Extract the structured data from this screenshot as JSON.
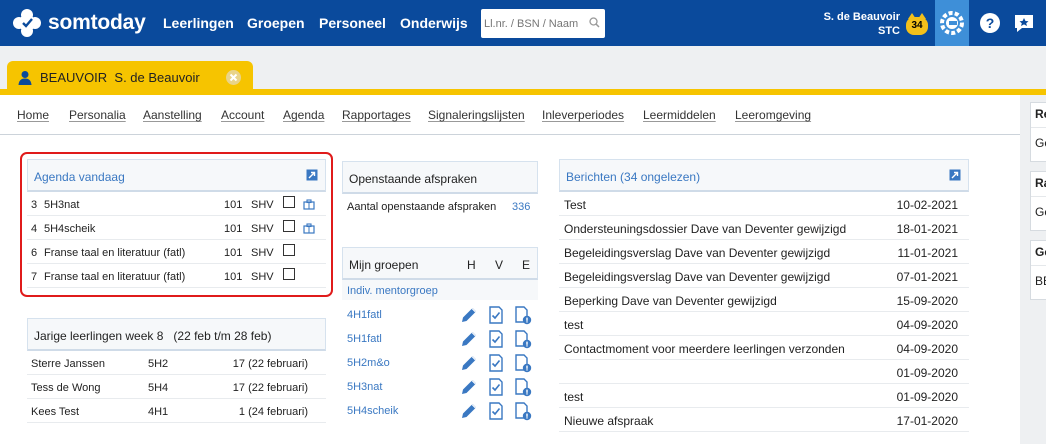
{
  "app": {
    "name": "somtoday"
  },
  "topnav": [
    {
      "label": "Leerlingen"
    },
    {
      "label": "Groepen"
    },
    {
      "label": "Personeel"
    },
    {
      "label": "Onderwijs"
    }
  ],
  "search": {
    "placeholder": "Ll.nr. / BSN / Naam"
  },
  "user": {
    "name": "S. de Beauvoir",
    "org": "STC",
    "notifications": "34"
  },
  "tab": {
    "label": "BEAUVOIR  S. de Beauvoir"
  },
  "subnav": [
    "Home",
    "Personalia",
    "Aanstelling",
    "Account",
    "Agenda",
    "Rapportages",
    "Signaleringslijsten",
    "Inleverperiodes",
    "Leermiddelen",
    "Leeromgeving"
  ],
  "agenda": {
    "title": "Agenda vandaag",
    "rows": [
      {
        "hour": "3",
        "subject": "5H3nat",
        "room": "101",
        "teacher": "SHV",
        "bag": true
      },
      {
        "hour": "4",
        "subject": "5H4scheik",
        "room": "101",
        "teacher": "SHV",
        "bag": true
      },
      {
        "hour": "6",
        "subject": "Franse taal en literatuur (fatl)",
        "room": "101",
        "teacher": "SHV",
        "bag": false
      },
      {
        "hour": "7",
        "subject": "Franse taal en literatuur (fatl)",
        "room": "101",
        "teacher": "SHV",
        "bag": false
      }
    ]
  },
  "birthdays": {
    "title": "Jarige leerlingen week 8   (22 feb t/m 28 feb)",
    "rows": [
      {
        "name": "Sterre Janssen",
        "class": "5H2",
        "date": "17 (22 februari)"
      },
      {
        "name": "Tess de Wong",
        "class": "5H4",
        "date": "17 (22 februari)"
      },
      {
        "name": "Kees Test",
        "class": "4H1",
        "date": "1 (24 februari)"
      }
    ]
  },
  "appointments": {
    "title": "Openstaande afspraken",
    "label": "Aantal openstaande afspraken",
    "count": "336"
  },
  "groups": {
    "title": "Mijn groepen",
    "col_h": "H",
    "col_v": "V",
    "col_e": "E",
    "mentor_label": "Indiv. mentorgroep",
    "items": [
      "4H1fatl",
      "5H1fatl",
      "5H2m&o",
      "5H3nat",
      "5H4scheik"
    ]
  },
  "messages": {
    "title": "Berichten (34 ongelezen)",
    "rows": [
      {
        "subject": "Test",
        "date": "10-02-2021"
      },
      {
        "subject": "Ondersteuningsdossier Dave van Deventer gewijzigd",
        "date": "18-01-2021"
      },
      {
        "subject": "Begeleidingsverslag Dave van Deventer gewijzigd",
        "date": "11-01-2021"
      },
      {
        "subject": "Begeleidingsverslag Dave van Deventer gewijzigd",
        "date": "07-01-2021"
      },
      {
        "subject": "Beperking Dave van Deventer gewijzigd",
        "date": "15-09-2020"
      },
      {
        "subject": "test",
        "date": "04-09-2020"
      },
      {
        "subject": "Contactmoment voor meerdere leerlingen verzonden",
        "date": "04-09-2020"
      },
      {
        "subject": "",
        "date": "01-09-2020"
      },
      {
        "subject": "test",
        "date": "01-09-2020"
      },
      {
        "subject": "Nieuwe afspraak",
        "date": "17-01-2020"
      }
    ]
  },
  "right_cards": [
    {
      "title": "Re",
      "text": "Ge"
    },
    {
      "title": "Ra",
      "text": "Ge"
    },
    {
      "title": "Ge",
      "text": "BE"
    }
  ],
  "colors": {
    "topbar": "#0a4a9c",
    "tab": "#f6c400",
    "link": "#3a78c2",
    "highlight": "#e01b1b"
  }
}
